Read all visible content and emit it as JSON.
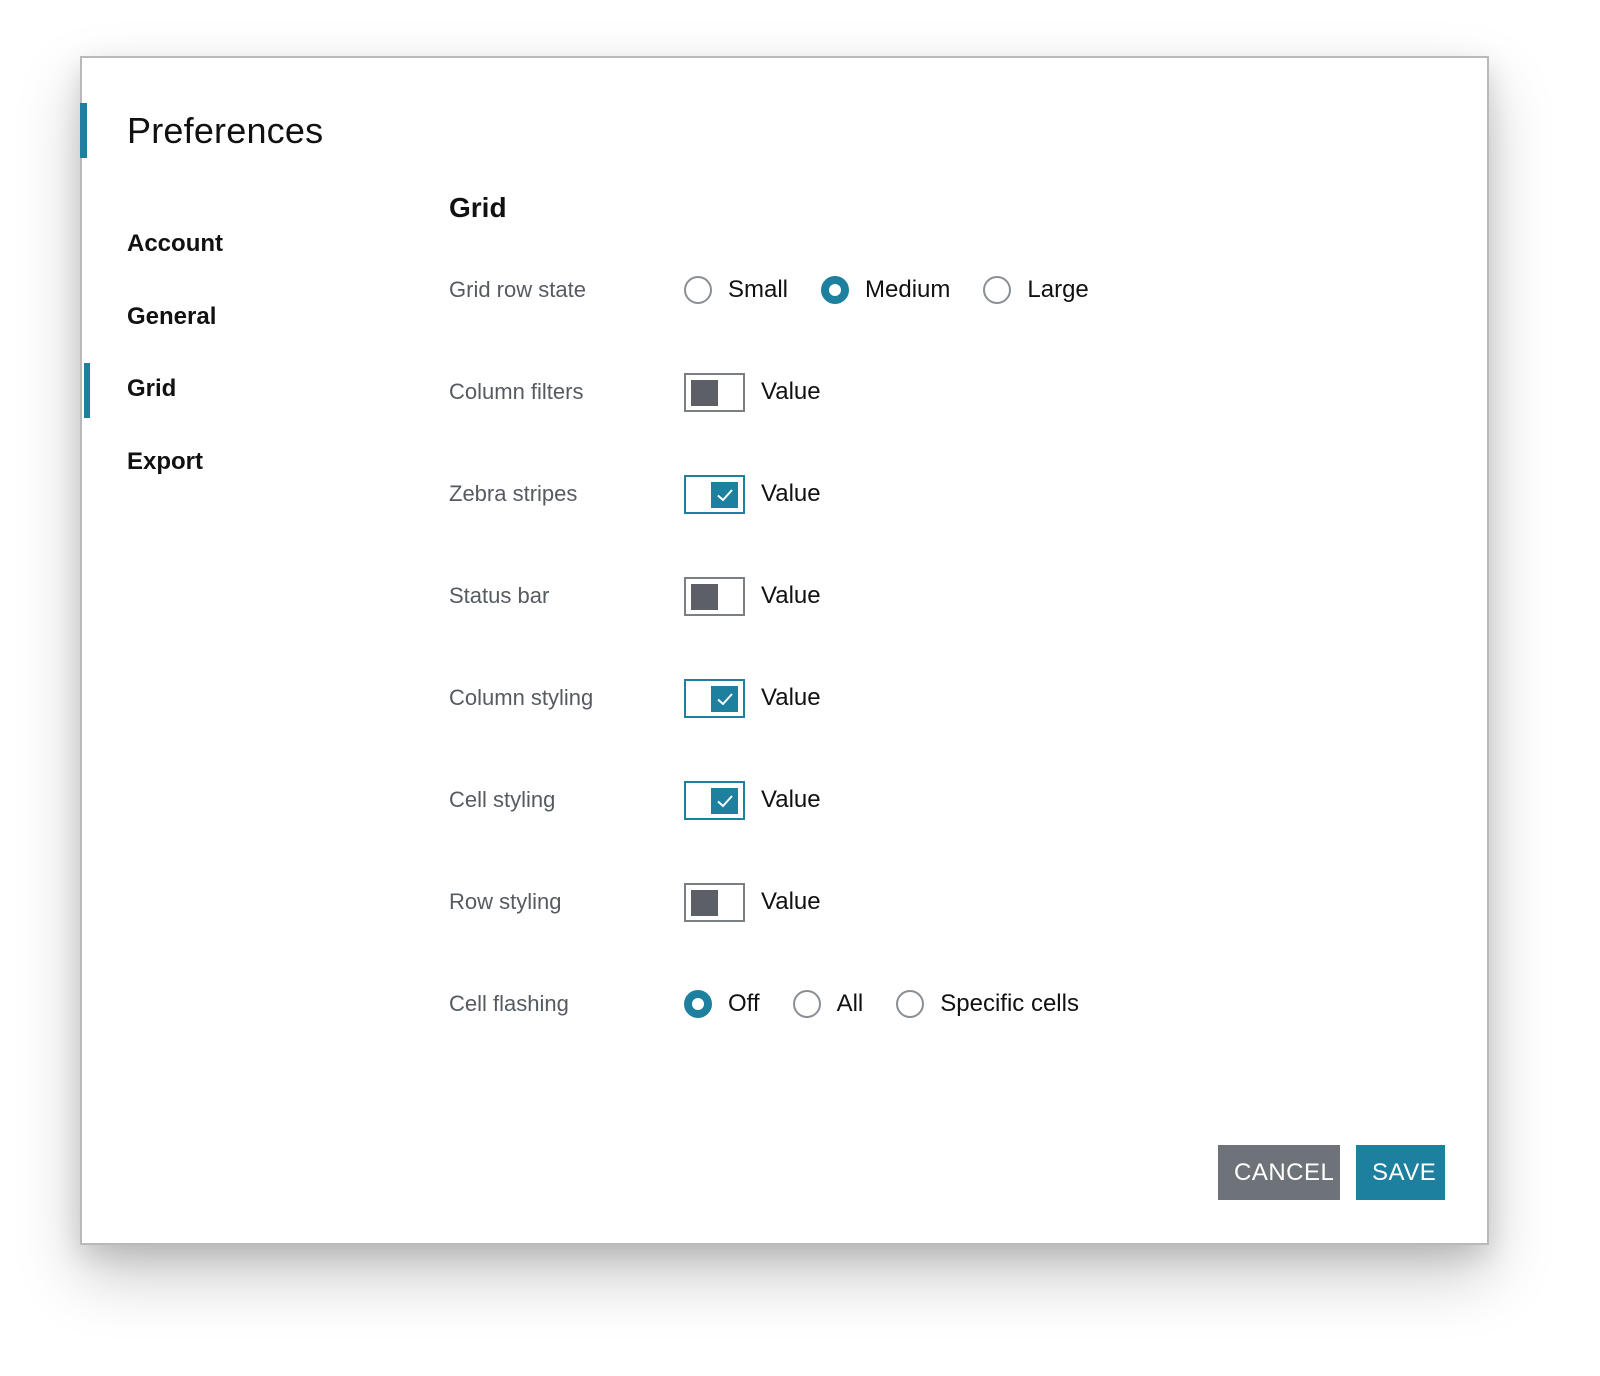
{
  "theme": {
    "accent": "#1d809f",
    "cancel": "#6e7379",
    "toggle_off": "#5c6066"
  },
  "dialog": {
    "title": "Preferences"
  },
  "nav": {
    "items": [
      {
        "label": "Account",
        "active": false
      },
      {
        "label": "General",
        "active": false
      },
      {
        "label": "Grid",
        "active": true
      },
      {
        "label": "Export",
        "active": false
      }
    ]
  },
  "section": {
    "title": "Grid",
    "grid_row_state": {
      "label": "Grid row state",
      "options": [
        "Small",
        "Medium",
        "Large"
      ],
      "selected": "Medium"
    },
    "toggles": [
      {
        "label": "Column filters",
        "value_label": "Value",
        "on": false
      },
      {
        "label": "Zebra stripes",
        "value_label": "Value",
        "on": true
      },
      {
        "label": "Status bar",
        "value_label": "Value",
        "on": false
      },
      {
        "label": "Column styling",
        "value_label": "Value",
        "on": true
      },
      {
        "label": "Cell styling",
        "value_label": "Value",
        "on": true
      },
      {
        "label": "Row styling",
        "value_label": "Value",
        "on": false
      }
    ],
    "cell_flashing": {
      "label": "Cell flashing",
      "options": [
        "Off",
        "All",
        "Specific cells"
      ],
      "selected": "Off"
    }
  },
  "footer": {
    "cancel_label": "CANCEL",
    "save_label": "SAVE"
  }
}
